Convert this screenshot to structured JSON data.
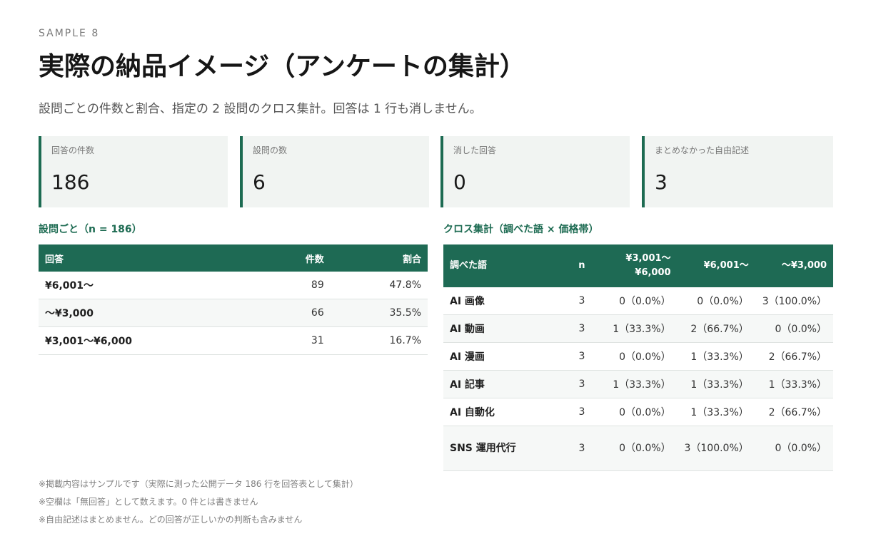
{
  "header": {
    "eyebrow": "SAMPLE 8",
    "title": "実際の納品イメージ（アンケートの集計）",
    "subtitle": "設問ごとの件数と割合、指定の 2 設問のクロス集計。回答は 1 行も消しません。"
  },
  "kpis": [
    {
      "label": "回答の件数",
      "value": "186"
    },
    {
      "label": "設問の数",
      "value": "6"
    },
    {
      "label": "消した回答",
      "value": "0"
    },
    {
      "label": "まとめなかった自由記述",
      "value": "3"
    }
  ],
  "accent_color": "#1d6b52",
  "per_question": {
    "title": "設問ごと（n = 186）",
    "headers": [
      "回答",
      "件数",
      "割合"
    ],
    "rows": [
      [
        "¥6,001〜",
        "89",
        "47.8%"
      ],
      [
        "〜¥3,000",
        "66",
        "35.5%"
      ],
      [
        "¥3,001〜¥6,000",
        "31",
        "16.7%"
      ]
    ]
  },
  "cross": {
    "title": "クロス集計（調べた語 × 価格帯）",
    "headers": [
      "調べた語",
      "n",
      "¥3,001〜 ¥6,000",
      "¥6,001〜",
      "〜¥3,000"
    ],
    "rows": [
      [
        "AI 画像",
        "3",
        "0（0.0%）",
        "0（0.0%）",
        "3（100.0%）"
      ],
      [
        "AI 動画",
        "3",
        "1（33.3%）",
        "2（66.7%）",
        "0（0.0%）"
      ],
      [
        "AI 漫画",
        "3",
        "0（0.0%）",
        "1（33.3%）",
        "2（66.7%）"
      ],
      [
        "AI 記事",
        "3",
        "1（33.3%）",
        "1（33.3%）",
        "1（33.3%）"
      ],
      [
        "AI 自動化",
        "3",
        "0（0.0%）",
        "1（33.3%）",
        "2（66.7%）"
      ],
      [
        "SNS 運用代行",
        "3",
        "0（0.0%）",
        "3（100.0%）",
        "0（0.0%）"
      ]
    ]
  },
  "notes": [
    "※掲載内容はサンプルです（実際に測った公開データ 186 行を回答表として集計）",
    "※空欄は「無回答」として数えます。0 件とは書きません",
    "※自由記述はまとめません。どの回答が正しいかの判断も含みません"
  ]
}
